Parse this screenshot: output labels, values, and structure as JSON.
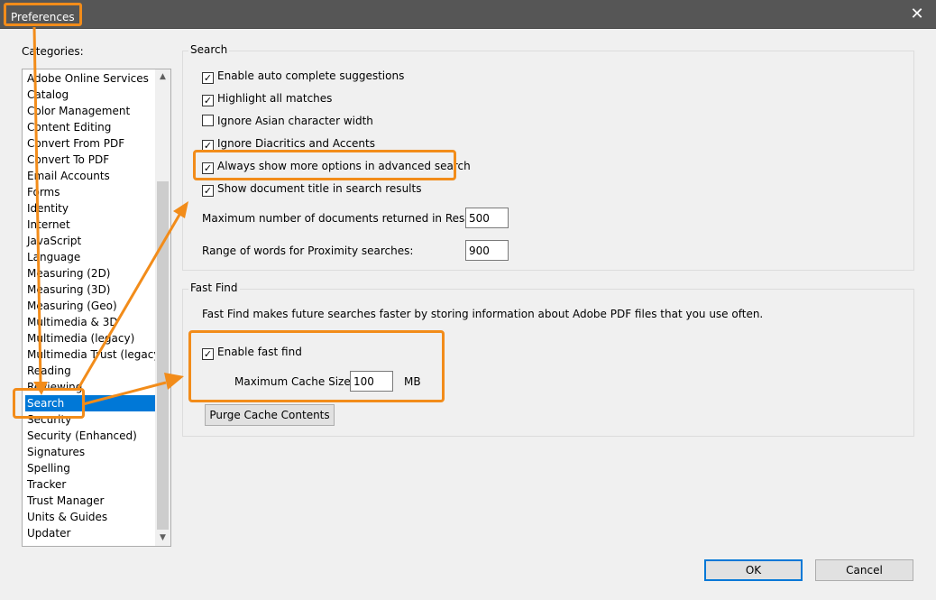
{
  "window": {
    "title": "Preferences",
    "close_glyph": "✕"
  },
  "categories": {
    "label": "Categories:",
    "items": [
      "Adobe Online Services",
      "Catalog",
      "Color Management",
      "Content Editing",
      "Convert From PDF",
      "Convert To PDF",
      "Email Accounts",
      "Forms",
      "Identity",
      "Internet",
      "JavaScript",
      "Language",
      "Measuring (2D)",
      "Measuring (3D)",
      "Measuring (Geo)",
      "Multimedia & 3D",
      "Multimedia (legacy)",
      "Multimedia Trust (legacy)",
      "Reading",
      "Reviewing",
      "Search",
      "Security",
      "Security (Enhanced)",
      "Signatures",
      "Spelling",
      "Tracker",
      "Trust Manager",
      "Units & Guides",
      "Updater"
    ],
    "selected": "Search"
  },
  "search": {
    "title": "Search",
    "options": [
      {
        "label": "Enable auto complete suggestions",
        "checked": true
      },
      {
        "label": "Highlight all matches",
        "checked": true
      },
      {
        "label": "Ignore Asian character width",
        "checked": false
      },
      {
        "label": "Ignore Diacritics and Accents",
        "checked": true
      },
      {
        "label": "Always show more options in advanced search",
        "checked": true
      },
      {
        "label": "Show document title in search results",
        "checked": true
      }
    ],
    "max_docs_label": "Maximum number of documents returned in Results:",
    "max_docs_value": "500",
    "proximity_label": "Range of words for Proximity searches:",
    "proximity_value": "900"
  },
  "fast_find": {
    "title": "Fast Find",
    "description": "Fast Find makes future searches faster by storing information about Adobe PDF files that you use often.",
    "enable_label": "Enable fast find",
    "enable_checked": true,
    "cache_label": "Maximum Cache Size:",
    "cache_value": "100",
    "cache_unit": "MB",
    "purge_label": "Purge Cache Contents"
  },
  "buttons": {
    "ok": "OK",
    "cancel": "Cancel"
  },
  "icons": {
    "check": "✓",
    "scroll_up": "▲",
    "scroll_down": "▼"
  },
  "colors": {
    "highlight": "#f28c1a",
    "selection": "#0078d7",
    "titlebar": "#565656"
  }
}
